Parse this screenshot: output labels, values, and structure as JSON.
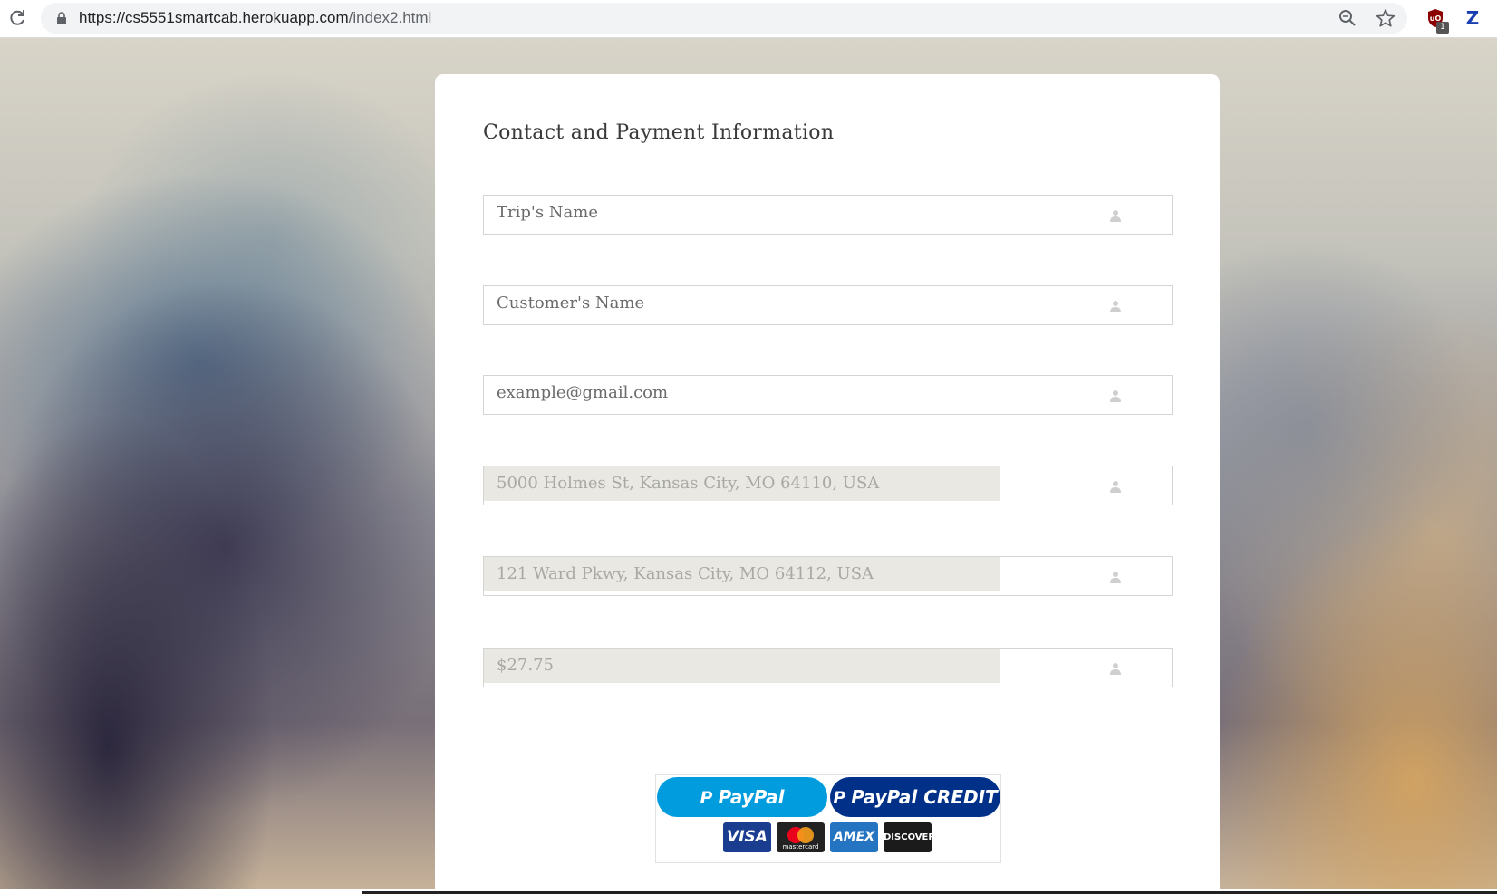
{
  "browser": {
    "url_host": "https://cs5551smartcab.herokuapp.com",
    "url_path": "/index2.html",
    "extension_badge": "1",
    "extension_z_label": "Z",
    "icons": [
      "reload-icon",
      "lock-icon",
      "zoom-icon",
      "star-icon",
      "shield-extension-icon",
      "z-extension-icon"
    ]
  },
  "form": {
    "title": "Contact and Payment Information",
    "fields": [
      {
        "value": "Trip's Name",
        "readonly": false
      },
      {
        "value": "Customer's Name",
        "readonly": false
      },
      {
        "value": "example@gmail.com",
        "readonly": false
      },
      {
        "value": "5000 Holmes St, Kansas City, MO 64110, USA",
        "readonly": true
      },
      {
        "value": "121 Ward Pkwy, Kansas City, MO 64112, USA",
        "readonly": true
      },
      {
        "value": "$27.75",
        "readonly": true
      }
    ],
    "field_icon": "user-icon"
  },
  "payment": {
    "paypal_label": "PayPal",
    "paypal_credit_label": "PayPal CREDIT",
    "paypal_mark": "P",
    "cards": {
      "visa": "VISA",
      "mastercard": "mastercard",
      "amex": "AMEX",
      "discover": "DISCOVER"
    }
  },
  "colors": {
    "paypal_blue": "#009cde",
    "paypal_dark": "#003087",
    "readonly_bg": "#e9e8e3"
  }
}
